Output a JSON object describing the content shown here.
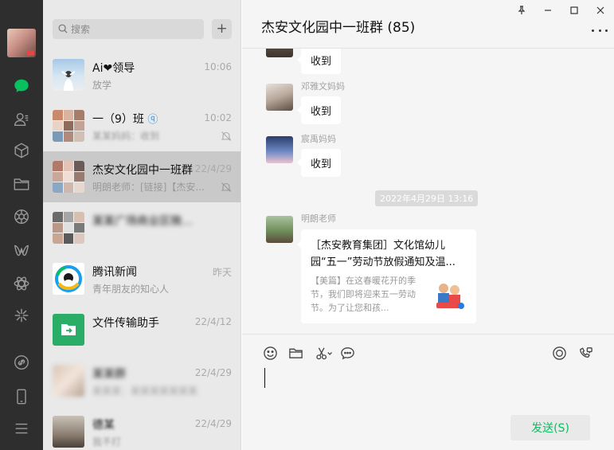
{
  "app": {
    "accent_color": "#07c160"
  },
  "rail": {
    "items": [
      {
        "name": "chats-icon",
        "active": true
      },
      {
        "name": "contacts-icon"
      },
      {
        "name": "favorites-icon"
      },
      {
        "name": "files-icon"
      },
      {
        "name": "moments-icon"
      },
      {
        "name": "channels-icon"
      },
      {
        "name": "search-discover-icon"
      },
      {
        "name": "mini-programs-icon"
      },
      {
        "name": "link-icon"
      },
      {
        "name": "phone-icon"
      },
      {
        "name": "menu-icon"
      }
    ]
  },
  "search": {
    "placeholder": "搜索"
  },
  "list": {
    "add_label": "+"
  },
  "chats": [
    {
      "name": "Ai❤领导",
      "time": "10:06",
      "preview": "放学",
      "muted": false,
      "blurred": false
    },
    {
      "name": "一（9）班",
      "time": "10:02",
      "preview": "某某妈妈：收到",
      "muted": true,
      "blurred": false
    },
    {
      "name": "杰安文化园中一班群",
      "time": "22/4/29",
      "preview": "明朗老师：[链接]【杰安...",
      "muted": true,
      "blurred": false,
      "selected": true
    },
    {
      "name": "某某广场商业区微信内部群",
      "time": "",
      "preview": "",
      "muted": false,
      "blurred": true
    },
    {
      "name": "腾讯新闻",
      "time": "昨天",
      "preview": "青年朋友的知心人",
      "muted": false,
      "blurred": false
    },
    {
      "name": "文件传输助手",
      "time": "22/4/12",
      "preview": "",
      "muted": false,
      "blurred": false
    },
    {
      "name": "某某群",
      "time": "22/4/29",
      "preview": "某某某：某某某某某某某",
      "muted": false,
      "blurred": true,
      "blur_name_only": true
    },
    {
      "name": "德某",
      "time": "22/4/29",
      "preview": "我不打",
      "muted": false,
      "blurred": true,
      "blur_name_only": true
    }
  ],
  "conversation": {
    "title": "杰安文化园中一班群 (85)",
    "messages": [
      {
        "sender": "",
        "text": "收到"
      },
      {
        "sender": "邓雅文妈妈",
        "text": "收到"
      },
      {
        "sender": "宸禹妈妈",
        "text": "收到"
      }
    ],
    "timestamp": "2022年4月29日 13:16",
    "card": {
      "sender": "明朗老师",
      "title": "［杰安教育集团］文化馆幼儿园“五一”劳动节放假通知及温...",
      "description": "【美篇】在这春暖花开的季节，我们即将迎来五一劳动节。为了让您和孩..."
    }
  },
  "input": {
    "tools": [
      "emoji-icon",
      "folder-icon",
      "scissors-icon",
      "chat-history-icon"
    ],
    "right_tools": [
      "voice-call-icon",
      "video-call-icon"
    ],
    "send_label": "发送(S)"
  }
}
